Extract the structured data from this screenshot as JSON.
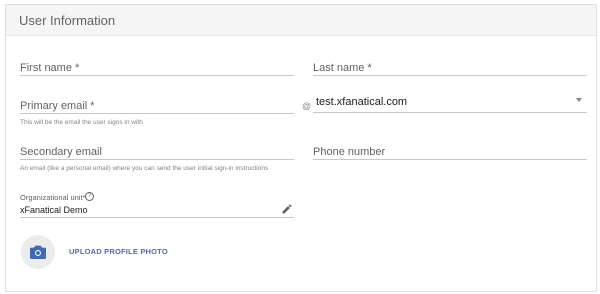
{
  "header": {
    "title": "User Information"
  },
  "form": {
    "first_name": {
      "label": "First name *"
    },
    "last_name": {
      "label": "Last name *"
    },
    "primary_email": {
      "label": "Primary email *",
      "helper": "This will be the email the user signs in with"
    },
    "domain": {
      "at_symbol": "@",
      "value": "test.xfanatical.com"
    },
    "secondary_email": {
      "label": "Secondary email",
      "helper": "An email (like a personal email) where you can send the user initial sign-in instructions"
    },
    "phone": {
      "label": "Phone number"
    },
    "org_unit": {
      "label": "Organizational unit*",
      "help_glyph": "?",
      "value": "xFanatical Demo"
    },
    "upload": {
      "label": "UPLOAD PROFILE PHOTO"
    }
  },
  "colors": {
    "accent": "#4a6fb3",
    "camera": "#3f6bb5"
  },
  "icons": {
    "help": "help-icon",
    "edit": "pencil-icon",
    "camera": "camera-icon",
    "dropdown": "chevron-down-icon"
  }
}
